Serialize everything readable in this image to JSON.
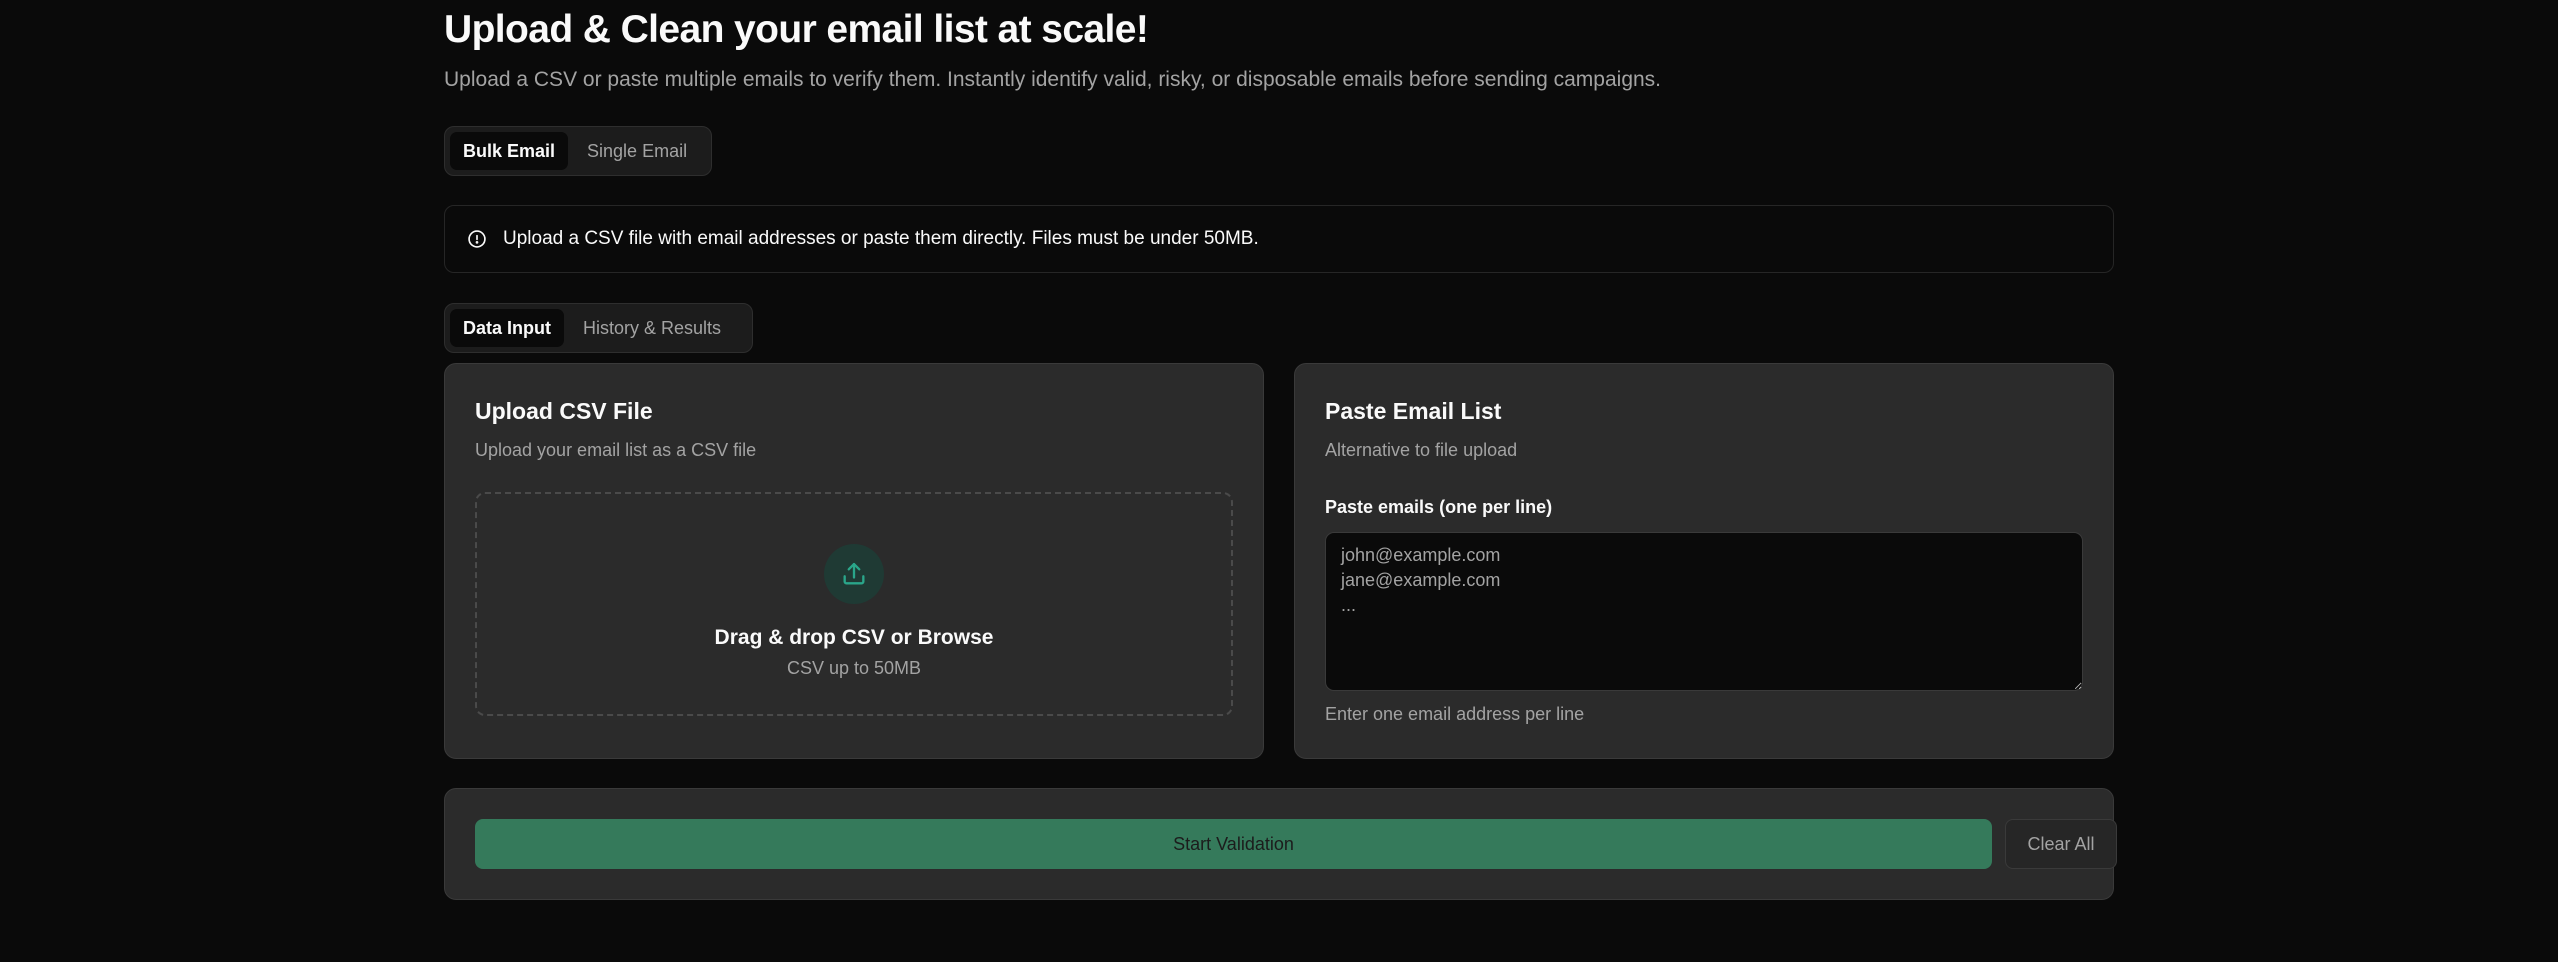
{
  "header": {
    "title": "Upload & Clean your email list at scale!",
    "subtitle": "Upload a CSV or paste multiple emails to verify them. Instantly identify valid, risky, or disposable emails before sending campaigns."
  },
  "mode_tabs": {
    "items": [
      {
        "label": "Bulk Email",
        "active": true
      },
      {
        "label": "Single Email",
        "active": false
      }
    ]
  },
  "alert": {
    "icon": "info-circle-icon",
    "text": "Upload a CSV file with email addresses or paste them directly. Files must be under 50MB."
  },
  "data_tabs": {
    "items": [
      {
        "label": "Data Input",
        "active": true
      },
      {
        "label": "History & Results",
        "active": false
      }
    ]
  },
  "upload_card": {
    "title": "Upload CSV File",
    "description": "Upload your email list as a CSV file",
    "dropzone": {
      "icon": "upload-icon",
      "main_text": "Drag & drop CSV or Browse",
      "sub_text": "CSV up to 50MB"
    }
  },
  "paste_card": {
    "title": "Paste Email List",
    "description": "Alternative to file upload",
    "field_label": "Paste emails (one per line)",
    "placeholder": "john@example.com\njane@example.com\n...",
    "value": "",
    "help_text": "Enter one email address per line"
  },
  "actions": {
    "start_label": "Start Validation",
    "clear_label": "Clear All"
  },
  "colors": {
    "background": "#0a0a0a",
    "card": "#2b2b2b",
    "accent_green": "#357a5b",
    "upload_icon": "#2aa68a"
  }
}
